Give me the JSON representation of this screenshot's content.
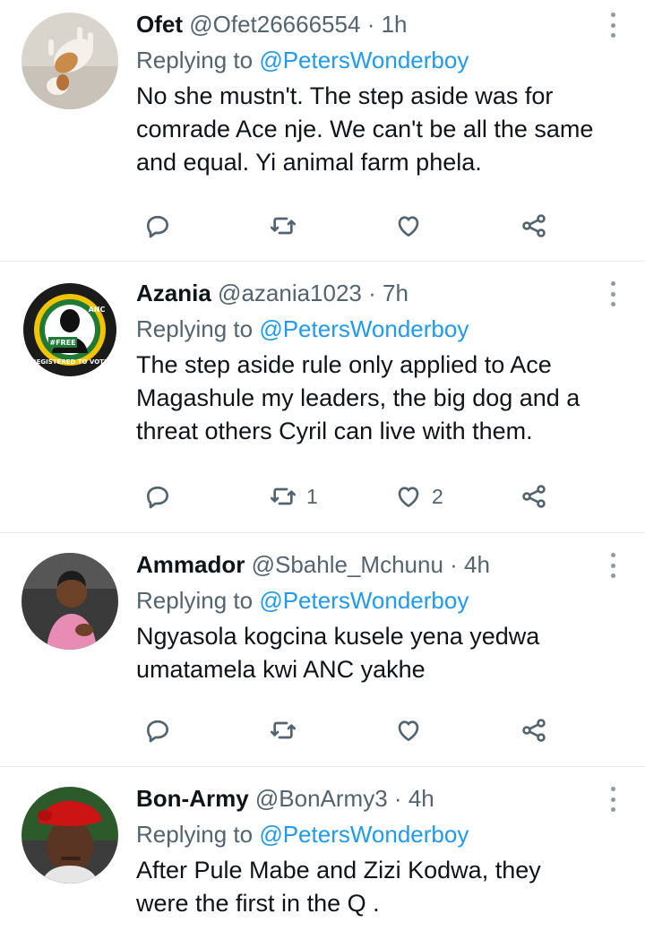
{
  "tweets": [
    {
      "display_name": "Ofet",
      "handle": "@Ofet26666554",
      "separator": "·",
      "time": "1h",
      "replying_prefix": "Replying to",
      "replying_to": "@PetersWonderboy",
      "text": "No she mustn't. The step aside was for comrade Ace nje. We can't be all the same and equal. Yi animal farm phela.",
      "avatar_icon": "dog-photo-avatar",
      "retweets": "",
      "likes": ""
    },
    {
      "display_name": "Azania",
      "handle": "@azania1023",
      "separator": "·",
      "time": "7h",
      "replying_prefix": "Replying to",
      "replying_to": "@PetersWonderboy",
      "text": "The step aside rule only applied to Ace Magashule my leaders, the big dog and a threat others Cyril can live with them.",
      "avatar_icon": "anc-badge-avatar",
      "avatar_badge_text": [
        "REGISTERED TO VOTE",
        "#FREE",
        "ANC"
      ],
      "retweets": "1",
      "likes": "2"
    },
    {
      "display_name": "Ammador",
      "handle": "@Sbahle_Mchunu",
      "separator": "·",
      "time": "4h",
      "replying_prefix": "Replying to",
      "replying_to": "@PetersWonderboy",
      "text": "Ngyasola kogcina kusele yena yedwa umatamela kwi ANC yakhe",
      "avatar_icon": "child-photo-avatar",
      "retweets": "",
      "likes": ""
    },
    {
      "display_name": "Bon-Army",
      "handle": "@BonArmy3",
      "separator": "·",
      "time": "4h",
      "replying_prefix": "Replying to",
      "replying_to": "@PetersWonderboy",
      "text": "After Pule Mabe and Zizi Kodwa, they were the first in the Q .",
      "avatar_icon": "red-beret-photo-avatar",
      "retweets": "",
      "likes": ""
    }
  ],
  "colors": {
    "text": "#0f1419",
    "secondary": "#536471",
    "link": "#1d9bf0",
    "divider": "#e7e9ea"
  },
  "icons": {
    "reply": "reply-icon",
    "retweet": "retweet-icon",
    "like": "heart-icon",
    "share": "share-icon",
    "more": "more-vertical-icon"
  }
}
